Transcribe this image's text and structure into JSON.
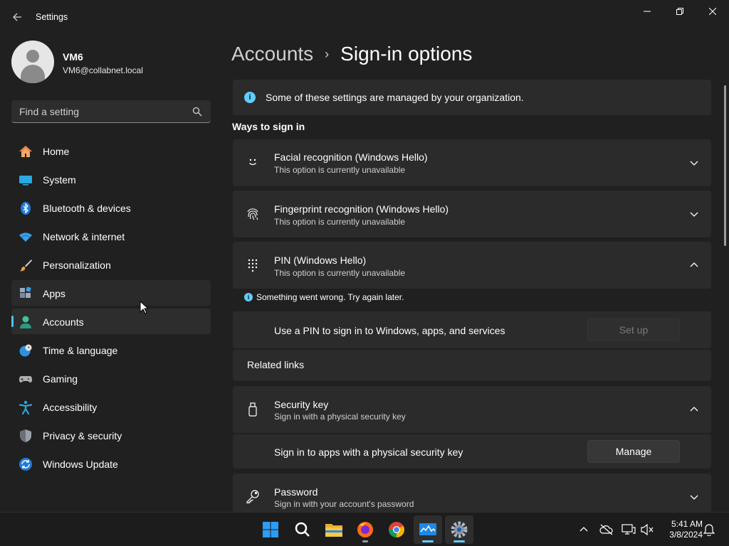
{
  "window": {
    "title": "Settings",
    "back_label": "Back"
  },
  "profile": {
    "name": "VM6",
    "email": "VM6@collabnet.local"
  },
  "search": {
    "placeholder": "Find a setting",
    "value": ""
  },
  "sidebar": {
    "items": [
      {
        "label": "Home",
        "icon": "home-icon"
      },
      {
        "label": "System",
        "icon": "system-icon"
      },
      {
        "label": "Bluetooth & devices",
        "icon": "bluetooth-icon"
      },
      {
        "label": "Network & internet",
        "icon": "wifi-icon"
      },
      {
        "label": "Personalization",
        "icon": "brush-icon"
      },
      {
        "label": "Apps",
        "icon": "apps-icon"
      },
      {
        "label": "Accounts",
        "icon": "accounts-icon",
        "selected": true
      },
      {
        "label": "Time & language",
        "icon": "clock-globe-icon"
      },
      {
        "label": "Gaming",
        "icon": "gamepad-icon"
      },
      {
        "label": "Accessibility",
        "icon": "accessibility-icon"
      },
      {
        "label": "Privacy & security",
        "icon": "shield-icon"
      },
      {
        "label": "Windows Update",
        "icon": "update-icon"
      }
    ]
  },
  "breadcrumb": {
    "parent": "Accounts",
    "separator": "›",
    "current": "Sign-in options"
  },
  "info_bar": {
    "text": "Some of these settings are managed by your organization."
  },
  "ways_to_sign_in": {
    "heading": "Ways to sign in",
    "facial": {
      "title": "Facial recognition (Windows Hello)",
      "subtitle": "This option is currently unavailable"
    },
    "fingerprint": {
      "title": "Fingerprint recognition (Windows Hello)",
      "subtitle": "This option is currently unavailable"
    },
    "pin": {
      "title": "PIN (Windows Hello)",
      "subtitle": "This option is currently unavailable",
      "error": "Something went wrong. Try again later.",
      "setup_text": "Use a PIN to sign in to Windows, apps, and services",
      "setup_button": "Set up",
      "related_links": "Related links"
    },
    "security_key": {
      "title": "Security key",
      "subtitle": "Sign in with a physical security key",
      "row_text": "Sign in to apps with a physical security key",
      "manage_button": "Manage"
    },
    "password": {
      "title": "Password",
      "subtitle": "Sign in with your account's password"
    }
  },
  "taskbar": {
    "apps": [
      "windows-start-icon",
      "search-icon",
      "file-explorer-icon",
      "firefox-icon",
      "chrome-icon",
      "network-monitor-icon",
      "settings-icon"
    ],
    "time": "5:41 AM",
    "date": "3/8/2024"
  },
  "colors": {
    "accent": "#4cc2ff",
    "background": "#202020",
    "card": "#2b2b2b"
  }
}
